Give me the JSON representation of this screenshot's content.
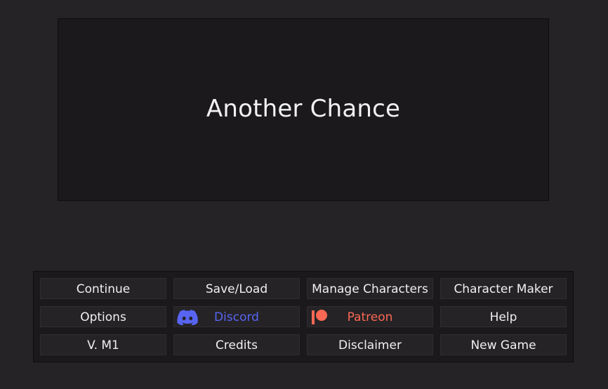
{
  "title": "Another Chance",
  "menu": {
    "rows": [
      [
        {
          "label": "Continue"
        },
        {
          "label": "Save/Load"
        },
        {
          "label": "Manage Characters"
        },
        {
          "label": "Character Maker"
        }
      ],
      [
        {
          "label": "Options"
        },
        {
          "label": "Discord",
          "icon": "discord-icon",
          "color": "#5865f2"
        },
        {
          "label": "Patreon",
          "icon": "patreon-icon",
          "color": "#f96854"
        },
        {
          "label": "Help"
        }
      ],
      [
        {
          "label": "V. M1"
        },
        {
          "label": "Credits"
        },
        {
          "label": "Disclaimer"
        },
        {
          "label": "New Game"
        }
      ]
    ]
  },
  "colors": {
    "background": "#252326",
    "panel": "#1b191c",
    "discord": "#5865f2",
    "patreon": "#f96854"
  }
}
